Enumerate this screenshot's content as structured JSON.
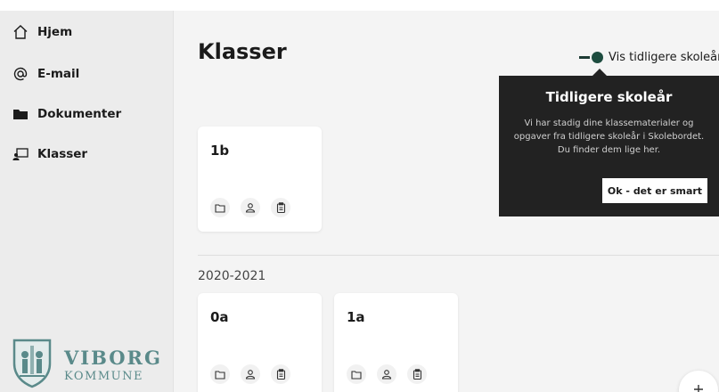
{
  "sidebar": {
    "items": [
      {
        "label": "Hjem",
        "icon": "home-icon"
      },
      {
        "label": "E-mail",
        "icon": "at-icon"
      },
      {
        "label": "Dokumenter",
        "icon": "folder-icon"
      },
      {
        "label": "Klasser",
        "icon": "class-icon"
      }
    ],
    "logo": {
      "line1": "VIBORG",
      "line2": "KOMMUNE"
    }
  },
  "main": {
    "title": "Klasser",
    "toggle_label": "Vis tidligere skoleår",
    "current_classes": [
      {
        "name": "1b"
      }
    ],
    "previous_year": {
      "label": "2020-2021",
      "classes": [
        {
          "name": "0a"
        },
        {
          "name": "1a"
        }
      ]
    }
  },
  "tooltip": {
    "title": "Tidligere skoleår",
    "body": "Vi har stadig dine klassematerialer og opgaver fra tidligere skoleår i Skolebordet. Du finder dem lige her.",
    "button": "Ok - det er smart"
  },
  "colors": {
    "accent": "#1d4c3f",
    "tooltip_bg": "#222222",
    "logo": "#5a8a8a"
  }
}
